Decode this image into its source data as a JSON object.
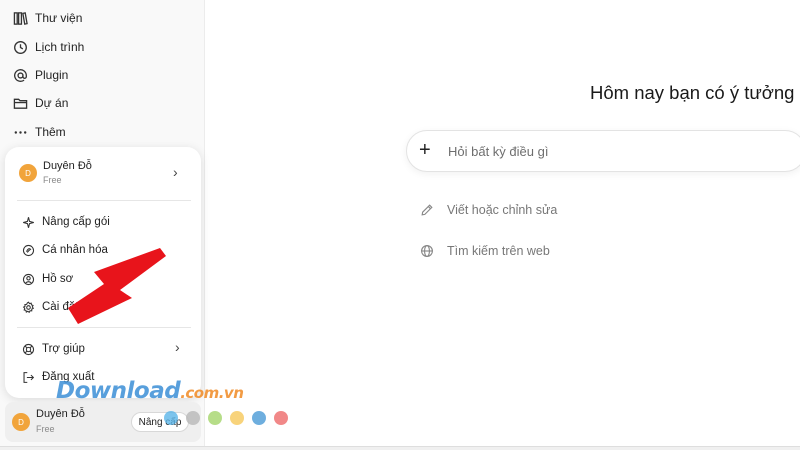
{
  "sidebar": {
    "items": [
      {
        "label": "Thư viện",
        "icon": "library-icon"
      },
      {
        "label": "Lịch trình",
        "icon": "clock-icon"
      },
      {
        "label": "Plugin",
        "icon": "at-icon"
      },
      {
        "label": "Dự án",
        "icon": "folder-icon"
      },
      {
        "label": "Thêm",
        "icon": "more-dots-icon"
      }
    ]
  },
  "menu": {
    "user": {
      "avatar": "D",
      "name": "Duyên Đỗ",
      "plan": "Free"
    },
    "items": [
      {
        "label": "Nâng cấp gói",
        "icon": "sparkle-icon"
      },
      {
        "label": "Cá nhân hóa",
        "icon": "personalize-icon"
      },
      {
        "label": "Hồ sơ",
        "icon": "profile-icon"
      },
      {
        "label": "Cài đặt",
        "icon": "gear-icon"
      }
    ],
    "help": {
      "label": "Trợ giúp",
      "icon": "lifebuoy-icon"
    },
    "logout": {
      "label": "Đăng xuất",
      "icon": "logout-icon"
    }
  },
  "bottom_user": {
    "avatar": "D",
    "name": "Duyên Đỗ",
    "plan": "Free",
    "upgrade_label": "Nâng cấp"
  },
  "main": {
    "greeting": "Hôm nay bạn có ý tưởng",
    "prompt_placeholder": "Hỏi bất kỳ điều gì",
    "suggestions": [
      {
        "label": "Viết hoặc chỉnh sửa",
        "icon": "pencil-icon"
      },
      {
        "label": "Tìm kiếm trên web",
        "icon": "globe-icon"
      }
    ]
  },
  "watermark": {
    "text": "Download",
    "domain": ".com.vn",
    "dot_colors": [
      "#5bb5e8",
      "#b8b8b8",
      "#a4d46a",
      "#f6c85a",
      "#4a9ad6",
      "#ee6a6a"
    ]
  },
  "colors": {
    "arrow": "#e8141b",
    "avatar": "#f1a43b",
    "watermark": "#3b8fd6"
  }
}
